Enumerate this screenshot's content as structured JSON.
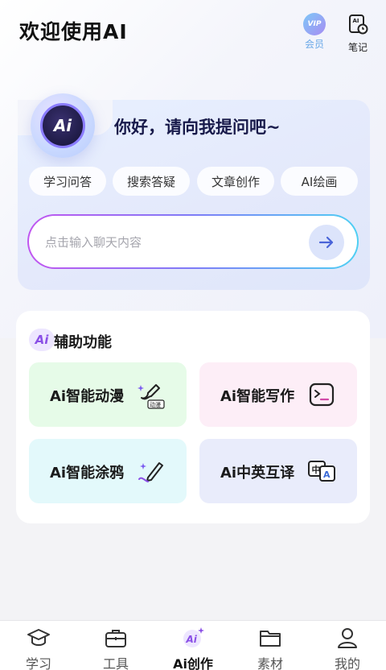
{
  "header": {
    "title": "欢迎使用AI",
    "vip_badge": "VIP",
    "vip_label": "会员",
    "notes_label": "笔记"
  },
  "hero": {
    "avatar_text": "Ai",
    "greeting": "你好，请向我提问吧~",
    "chips": [
      "学习问答",
      "搜索答疑",
      "文章创作",
      "AI绘画"
    ],
    "input_placeholder": "点击输入聊天内容"
  },
  "aux": {
    "icon_text": "Ai",
    "title": "辅助功能",
    "features": [
      {
        "label": "Ai智能动漫",
        "icon": "anime-brush-icon",
        "icon_text": "动漫"
      },
      {
        "label": "Ai智能写作",
        "icon": "writing-icon"
      },
      {
        "label": "Ai智能涂鸦",
        "icon": "doodle-pencil-icon"
      },
      {
        "label": "Ai中英互译",
        "icon": "translate-icon",
        "icon_text_a": "中",
        "icon_text_b": "A"
      }
    ]
  },
  "tabbar": {
    "items": [
      {
        "label": "学习",
        "icon": "graduation-cap-icon"
      },
      {
        "label": "工具",
        "icon": "toolbox-icon"
      },
      {
        "label": "Ai创作",
        "icon": "ai-sparkle-icon",
        "icon_text": "Ai"
      },
      {
        "label": "素材",
        "icon": "folder-icon"
      },
      {
        "label": "我的",
        "icon": "user-icon"
      }
    ],
    "active_index": 2
  },
  "colors": {
    "accent_purple": "#8a4fe6",
    "input_gradient": [
      "#c156f0",
      "#7e7cf7",
      "#4fd0f3"
    ],
    "vip_label": "#6aa8e8",
    "feature_backgrounds": [
      "#e6fbe8",
      "#fdeef7",
      "#e3f9fb",
      "#e9ecfb"
    ]
  }
}
